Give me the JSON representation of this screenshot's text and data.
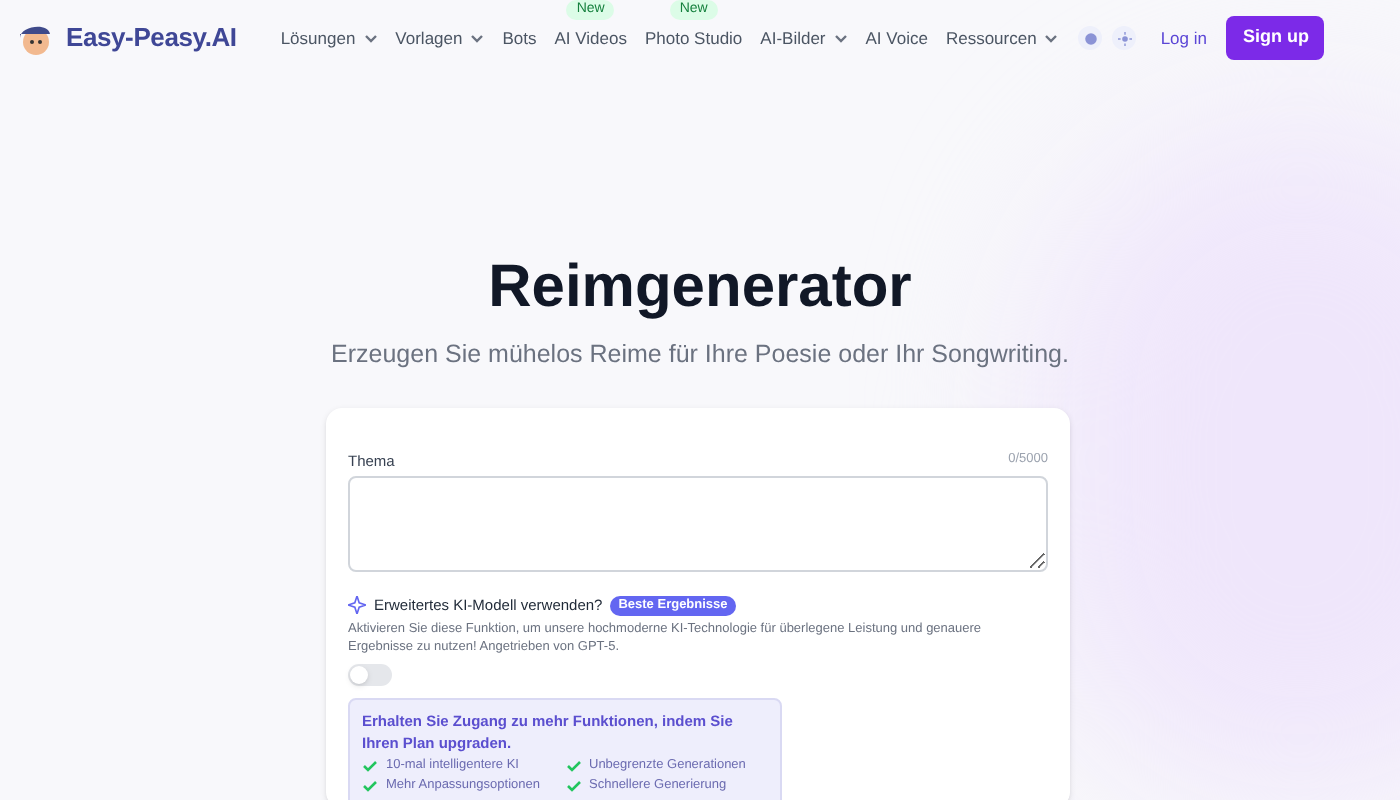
{
  "brand": "Easy-Peasy.AI",
  "nav": [
    {
      "label": "Lösungen",
      "dropdown": true
    },
    {
      "label": "Vorlagen",
      "dropdown": true
    },
    {
      "label": "Bots",
      "dropdown": false
    },
    {
      "label": "AI Videos",
      "dropdown": false,
      "badge": "New"
    },
    {
      "label": "Photo Studio",
      "dropdown": false,
      "badge": "New"
    },
    {
      "label": "AI-Bilder",
      "dropdown": true
    },
    {
      "label": "AI Voice",
      "dropdown": false
    },
    {
      "label": "Ressourcen",
      "dropdown": true
    }
  ],
  "login": "Log in",
  "signup": "Sign up",
  "title": "Reimgenerator",
  "subtitle": "Erzeugen Sie mühelos Reime für Ihre Poesie oder Ihr Songwriting.",
  "form": {
    "label": "Thema",
    "counter": "0/5000",
    "advanced": {
      "label": "Erweitertes KI-Modell verwenden?",
      "badge": "Beste Ergebnisse",
      "description": "Aktivieren Sie diese Funktion, um unsere hochmoderne KI-Technologie für überlegene Leistung und genauere Ergebnisse zu nutzen! Angetrieben von GPT-5.",
      "on": false
    },
    "upgrade": {
      "title": "Erhalten Sie Zugang zu mehr Funktionen, indem Sie Ihren Plan upgraden.",
      "features": [
        "10-mal intelligentere KI",
        "Unbegrenzte Generationen",
        "Mehr Anpassungsoptionen",
        "Schnellere Generierung"
      ]
    }
  }
}
